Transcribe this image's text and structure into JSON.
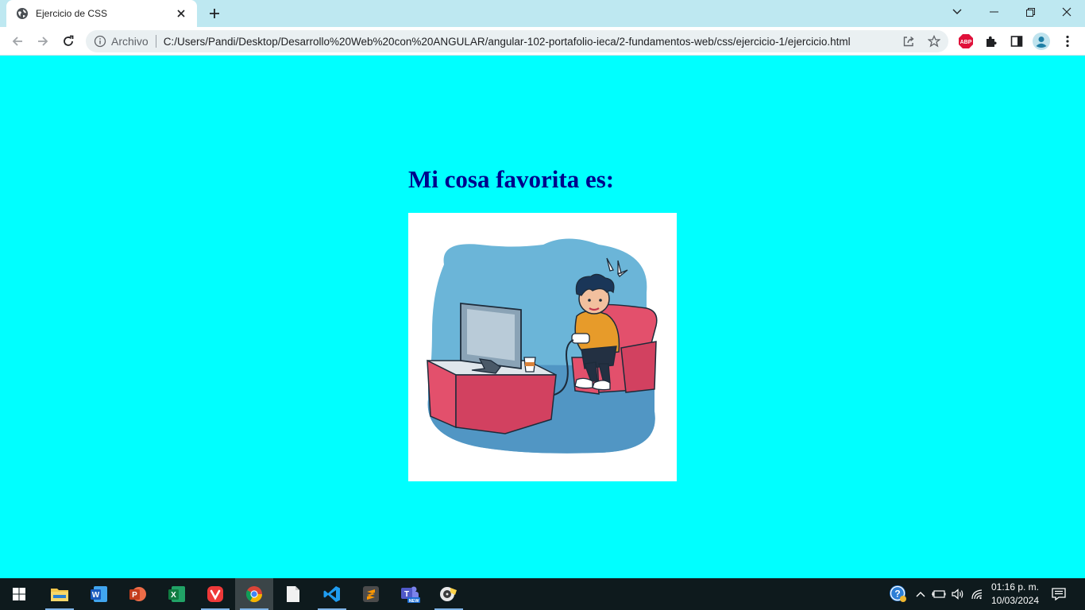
{
  "browser": {
    "tab": {
      "title": "Ejercicio de CSS",
      "icon": "globe-icon"
    },
    "omnibox": {
      "chip": "Archivo",
      "url": "C:/Users/Pandi/Desktop/Desarrollo%20Web%20con%20ANGULAR/angular-102-portafolio-ieca/2-fundamentos-web/css/ejercicio-1/ejercicio.html"
    },
    "extensions": {
      "abp_label": "ABP"
    }
  },
  "page": {
    "background_color": "#00ffff",
    "heading": "Mi cosa favorita es:",
    "heading_color": "#00008b",
    "image_subject": "gamer-illustration"
  },
  "taskbar": {
    "apps": [
      "file-explorer",
      "word",
      "powerpoint",
      "excel",
      "vivaldi",
      "chrome",
      "notepad",
      "vscode",
      "sublime-text",
      "teams",
      "media-app"
    ],
    "teams_badge": "NEW",
    "clock": {
      "time": "01:16 p. m.",
      "date": "10/03/2024"
    }
  }
}
